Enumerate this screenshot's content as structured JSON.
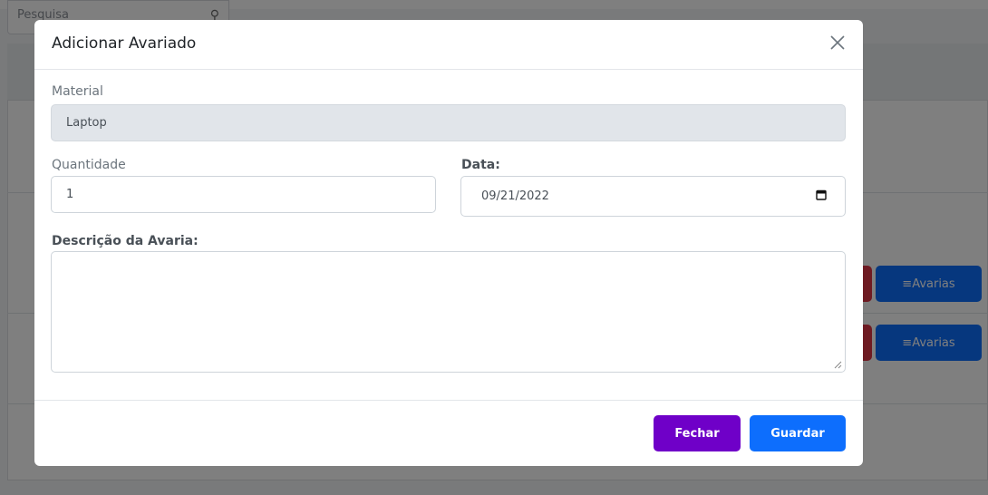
{
  "background": {
    "search_placeholder": "Pesquisa",
    "row_action_label": "≡Avarias"
  },
  "modal": {
    "title": "Adicionar Avariado",
    "close_icon": "close-icon",
    "material": {
      "label": "Material",
      "value": "Laptop"
    },
    "quantidade": {
      "label": "Quantidade",
      "value": "1"
    },
    "data": {
      "label": "Data:",
      "value": "09/21/2022",
      "icon": "calendar-icon"
    },
    "descricao": {
      "label": "Descrição da Avaria:",
      "value": ""
    },
    "buttons": {
      "close_label": "Fechar",
      "save_label": "Guardar"
    },
    "colors": {
      "close_button": "#6f00c8",
      "save_button": "#0d6efd",
      "danger": "#dc3545"
    }
  }
}
